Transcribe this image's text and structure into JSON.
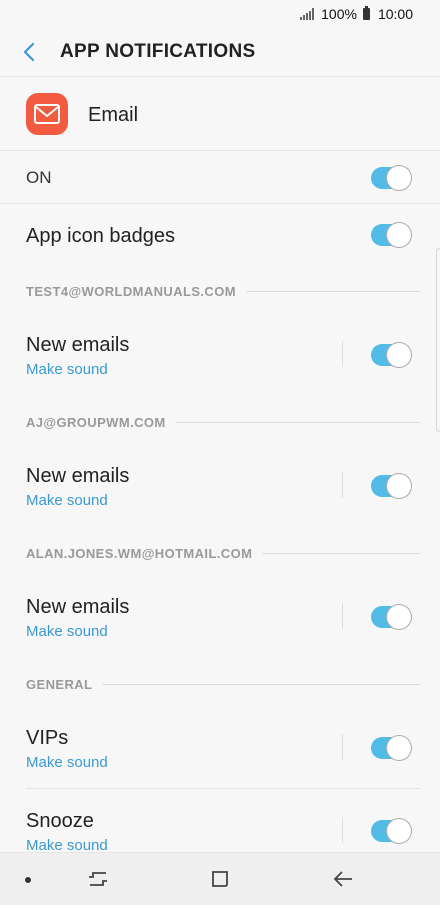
{
  "status_bar": {
    "battery": "100%",
    "time": "10:00"
  },
  "header": {
    "title": "APP NOTIFICATIONS"
  },
  "app": {
    "name": "Email"
  },
  "on_row": {
    "label": "ON"
  },
  "badges_row": {
    "label": "App icon badges"
  },
  "accounts": [
    {
      "header": "TEST4@WORLDMANUALS.COM",
      "title": "New emails",
      "subtitle": "Make sound"
    },
    {
      "header": "AJ@GROUPWM.COM",
      "title": "New emails",
      "subtitle": "Make sound"
    },
    {
      "header": "ALAN.JONES.WM@HOTMAIL.COM",
      "title": "New emails",
      "subtitle": "Make sound"
    }
  ],
  "general": {
    "header": "GENERAL",
    "items": [
      {
        "title": "VIPs",
        "subtitle": "Make sound"
      },
      {
        "title": "Snooze",
        "subtitle": "Make sound"
      }
    ]
  },
  "colors": {
    "accent": "#53bce6",
    "link": "#3a9ad0",
    "app_icon": "#f25b40"
  }
}
